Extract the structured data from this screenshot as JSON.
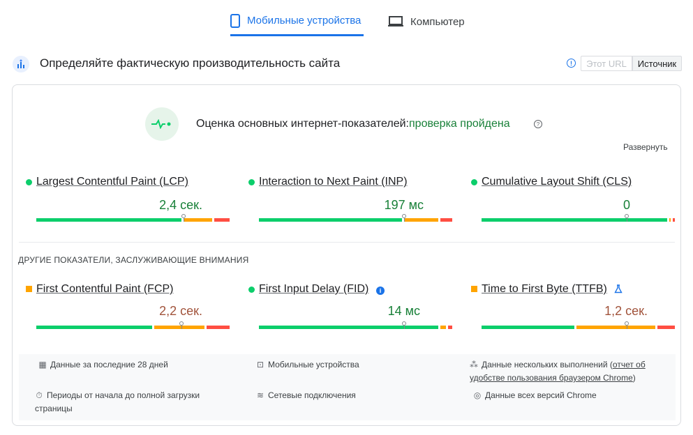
{
  "tabs": [
    {
      "label": "Мобильные устройства",
      "icon": "phone-icon",
      "active": true
    },
    {
      "label": "Компьютер",
      "icon": "laptop-icon",
      "active": false
    }
  ],
  "header": {
    "title": "Определяйте фактическую производительность сайта",
    "toggle_url": "Этот URL",
    "toggle_origin": "Источник"
  },
  "assessment": {
    "label": "Оценка основных интернет-показателей:",
    "status": "проверка пройдена",
    "expand": "Развернуть"
  },
  "core_metrics": [
    {
      "name": "Largest Contentful Paint (LCP)",
      "value": "2,4 сек.",
      "rating": "good",
      "shares": {
        "good": 0.76,
        "avg": 0.16,
        "poor": 0.08
      },
      "marker": 0.76
    },
    {
      "name": "Interaction to Next Paint (INP)",
      "value": "197 мс",
      "rating": "good",
      "shares": {
        "good": 0.75,
        "avg": 0.19,
        "poor": 0.06
      },
      "marker": 0.75
    },
    {
      "name": "Cumulative Layout Shift (CLS)",
      "value": "0",
      "rating": "good",
      "shares": {
        "good": 0.97,
        "avg": 0.02,
        "poor": 0.01
      },
      "marker": 0.75
    }
  ],
  "other_title": "ДРУГИЕ ПОКАЗАТЕЛИ, ЗАСЛУЖИВАЮЩИЕ ВНИМАНИЯ",
  "other_metrics": [
    {
      "name": "First Contentful Paint (FCP)",
      "value": "2,2 сек.",
      "rating": "average",
      "shares": {
        "good": 0.61,
        "avg": 0.27,
        "poor": 0.12
      },
      "marker": 0.75
    },
    {
      "name": "First Input Delay (FID)",
      "value": "14 мс",
      "rating": "good",
      "shares": {
        "good": 0.94,
        "avg": 0.04,
        "poor": 0.02
      },
      "marker": 0.75
    },
    {
      "name": "Time to First Byte (TTFB)",
      "value": "1,2 сек.",
      "rating": "average",
      "shares": {
        "good": 0.49,
        "avg": 0.42,
        "poor": 0.09
      },
      "marker": 0.75
    }
  ],
  "footer": {
    "period": "Данные за последние 28 дней",
    "device": "Мобильные устройства",
    "runs_prefix": "Данные нескольких выполнений (",
    "runs_link": "отчет об удобстве пользования браузером Chrome",
    "runs_suffix": ")",
    "durations": "Периоды от начала до полной загрузки страницы",
    "network": "Сетевые подключения",
    "versions": "Данные всех версий Chrome"
  },
  "colors": {
    "good": "#0cce6b",
    "average": "#ffa400",
    "poor": "#ff4e42",
    "accent": "#1a73e8"
  }
}
